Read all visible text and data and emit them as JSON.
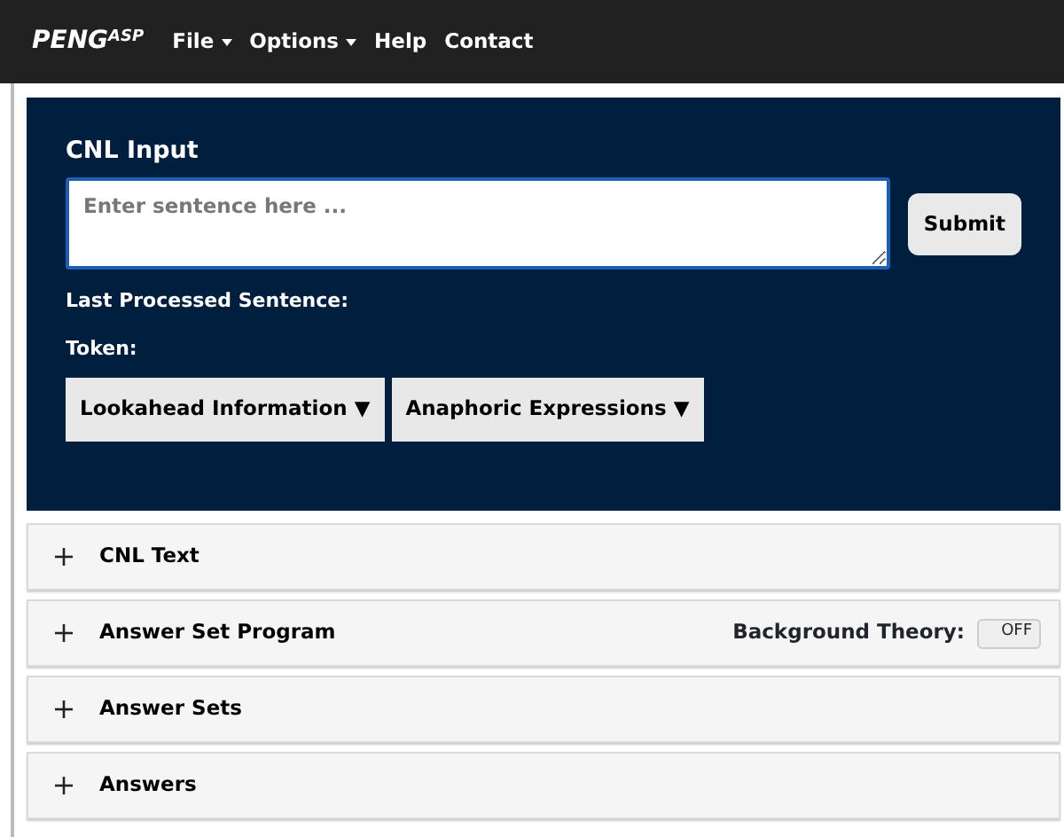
{
  "navbar": {
    "brand": "PENG$^{ASP}$",
    "menu": [
      {
        "label": "File",
        "dropdown": true
      },
      {
        "label": "Options",
        "dropdown": true
      },
      {
        "label": "Help",
        "dropdown": false
      },
      {
        "label": "Contact",
        "dropdown": false
      }
    ]
  },
  "input_panel": {
    "title": "CNL Input",
    "sentence_field": {
      "placeholder": "Enter sentence here ..."
    },
    "submit": "Submit",
    "last_processed_label": "Last Processed Sentence:",
    "token_label": "Token:",
    "buttons": [
      "Lookahead Information ▼",
      "Anaphoric Expressions ▼"
    ]
  },
  "sections": [
    {
      "title": "CNL Text",
      "expanded": false
    },
    {
      "title": "Answer Set Program",
      "expanded": false,
      "toggle": {
        "label": "Background Theory:",
        "state_text": "OFF",
        "on": false
      }
    },
    {
      "title": "Answer Sets",
      "expanded": false
    },
    {
      "title": "Answers",
      "expanded": false
    }
  ]
}
